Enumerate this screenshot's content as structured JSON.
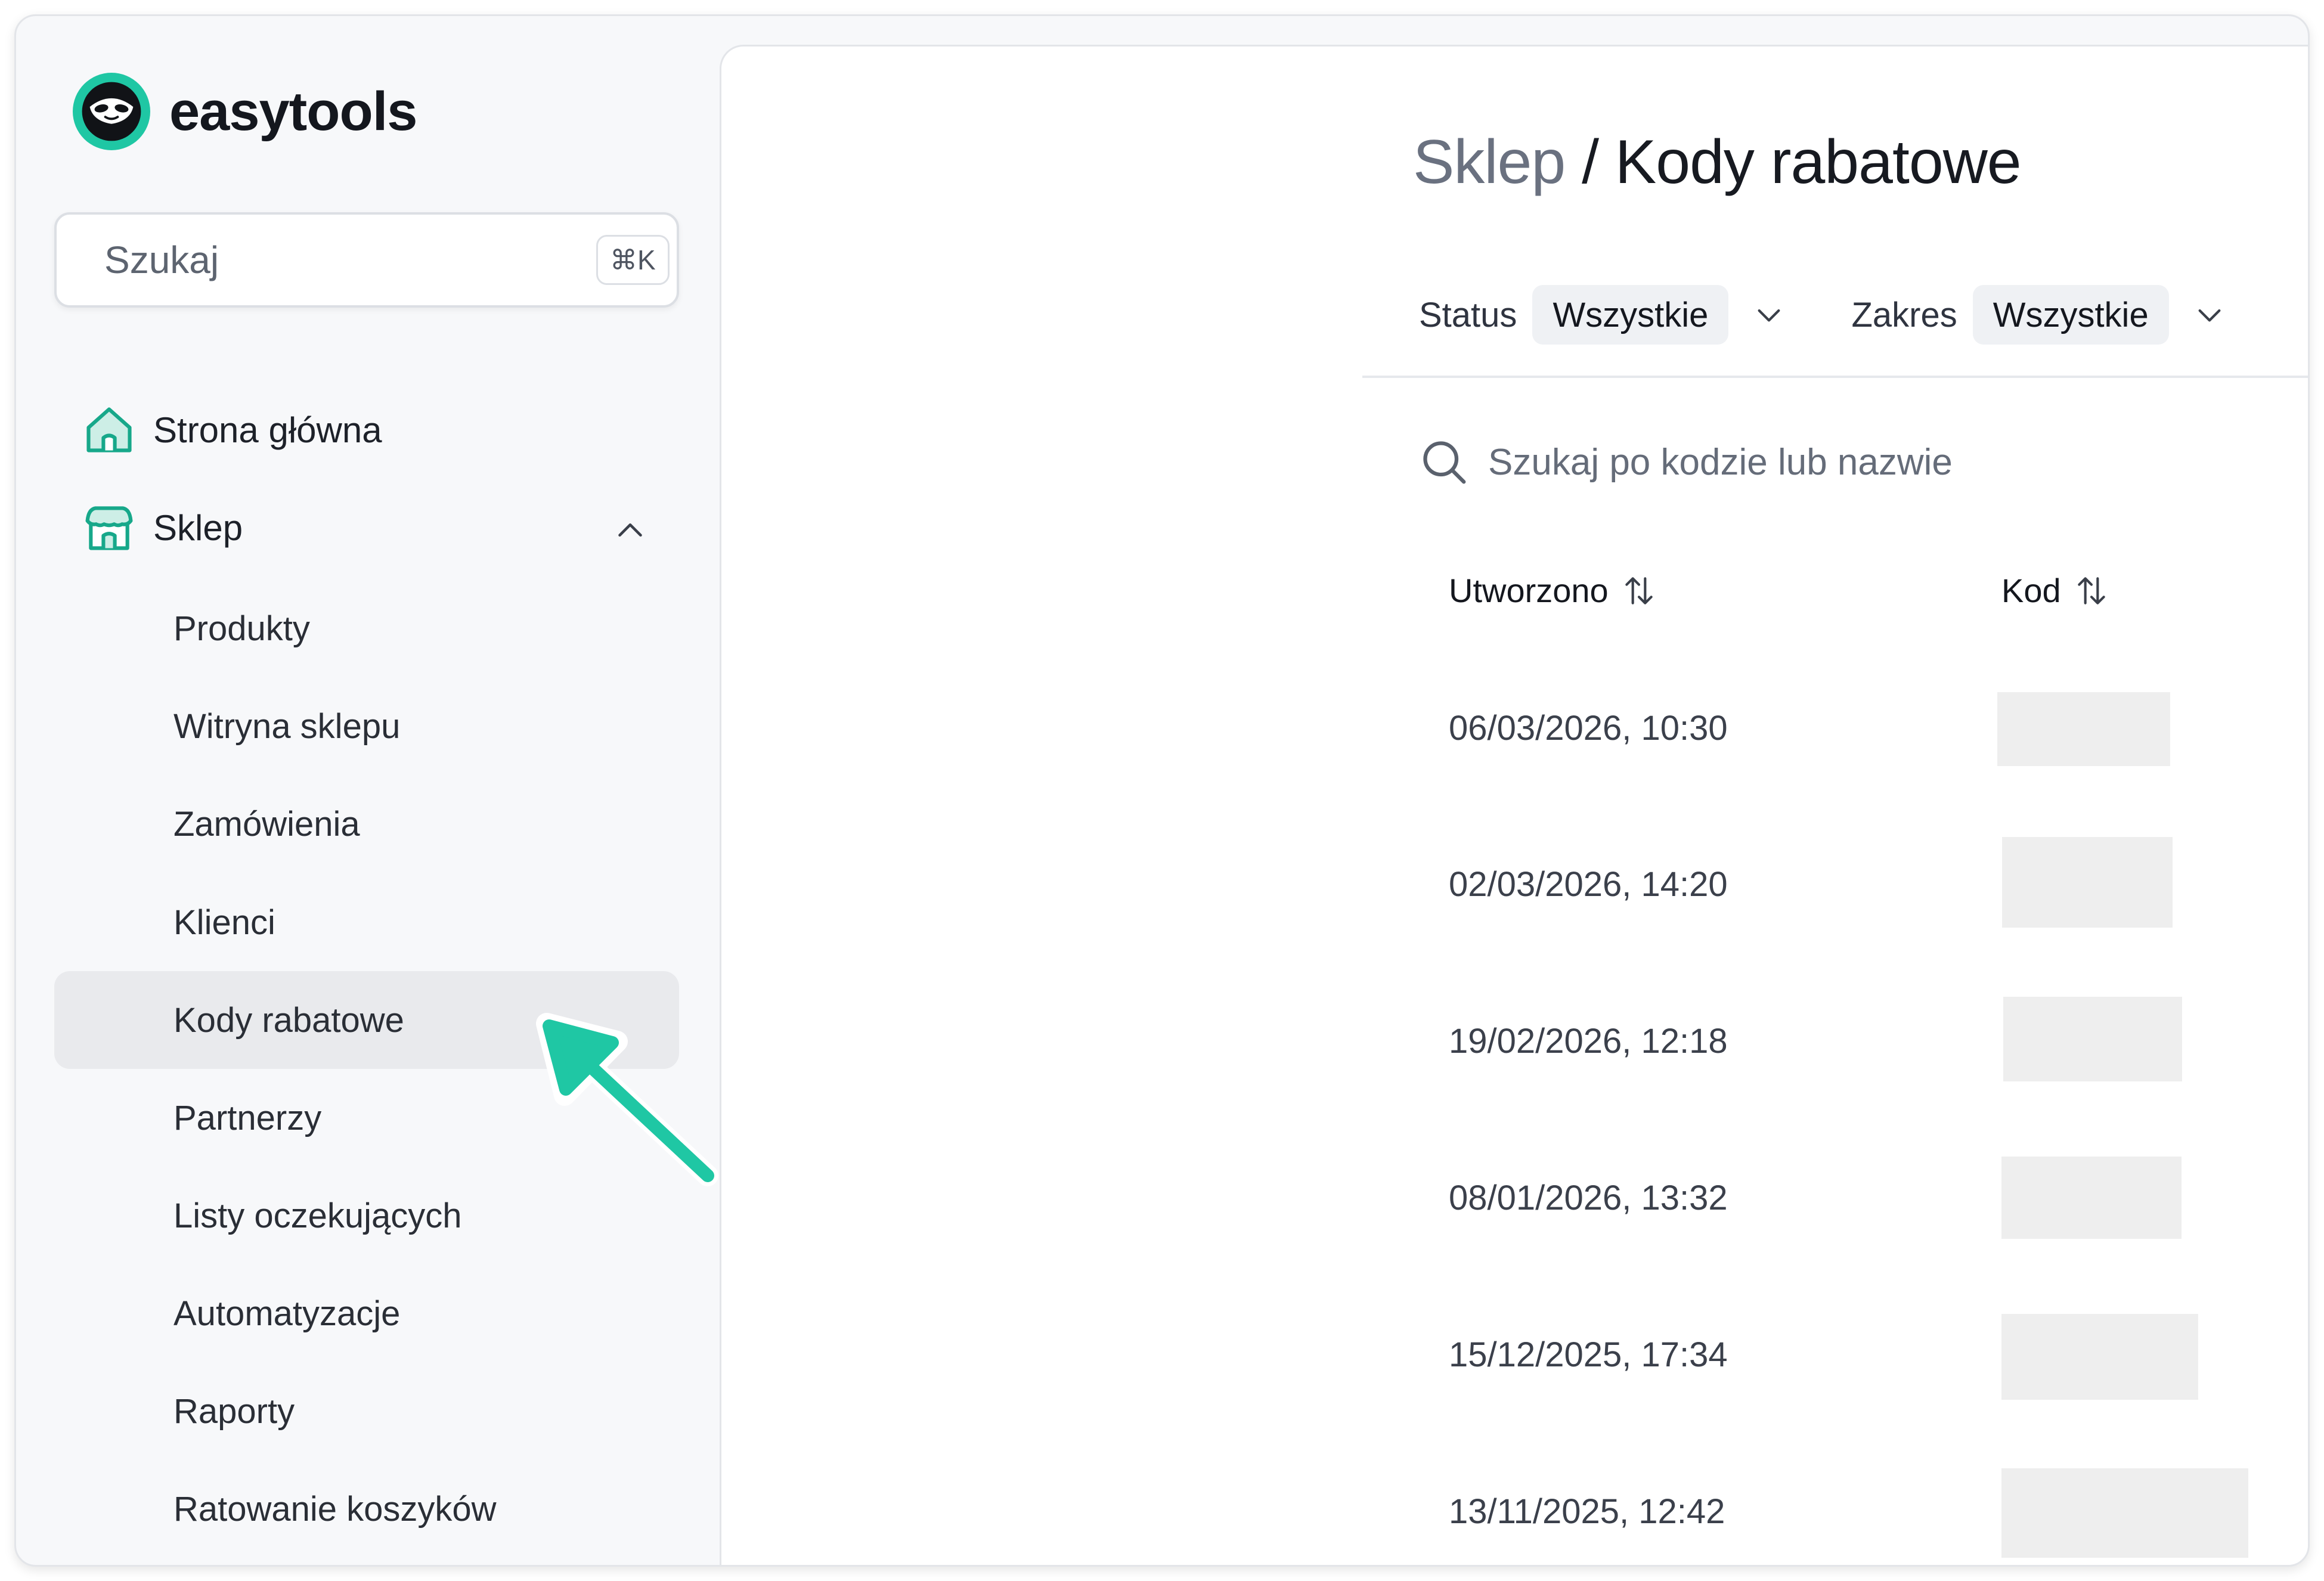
{
  "app": {
    "name": "easytools"
  },
  "sidebar": {
    "search": {
      "placeholder": "Szukaj",
      "shortcut": "⌘K"
    },
    "nav": [
      {
        "label": "Strona główna",
        "icon": "home-icon"
      },
      {
        "label": "Sklep",
        "icon": "store-icon",
        "expanded": true
      }
    ],
    "shop_items": [
      {
        "label": "Produkty"
      },
      {
        "label": "Witryna sklepu"
      },
      {
        "label": "Zamówienia"
      },
      {
        "label": "Klienci"
      },
      {
        "label": "Kody rabatowe",
        "active": true
      },
      {
        "label": "Partnerzy"
      },
      {
        "label": "Listy oczekujących"
      },
      {
        "label": "Automatyzacje"
      },
      {
        "label": "Raporty"
      },
      {
        "label": "Ratowanie koszyków"
      }
    ]
  },
  "main": {
    "breadcrumb": {
      "parent": "Sklep",
      "separator": "/",
      "current": "Kody rabatowe"
    },
    "filters": [
      {
        "label": "Status",
        "value": "Wszystkie"
      },
      {
        "label": "Zakres",
        "value": "Wszystkie"
      }
    ],
    "search": {
      "placeholder": "Szukaj po kodzie lub nazwie"
    },
    "table": {
      "columns": [
        "Utworzono",
        "Kod"
      ],
      "rows": [
        {
          "created": "06/03/2026, 10:30"
        },
        {
          "created": "02/03/2026, 14:20"
        },
        {
          "created": "19/02/2026, 12:18"
        },
        {
          "created": "08/01/2026, 13:32"
        },
        {
          "created": "15/12/2025, 17:34"
        },
        {
          "created": "13/11/2025, 12:42"
        }
      ]
    }
  },
  "colors": {
    "accent": "#1fc7a4",
    "active_bg": "#e9eaed",
    "redacted": "#eeeeee"
  }
}
